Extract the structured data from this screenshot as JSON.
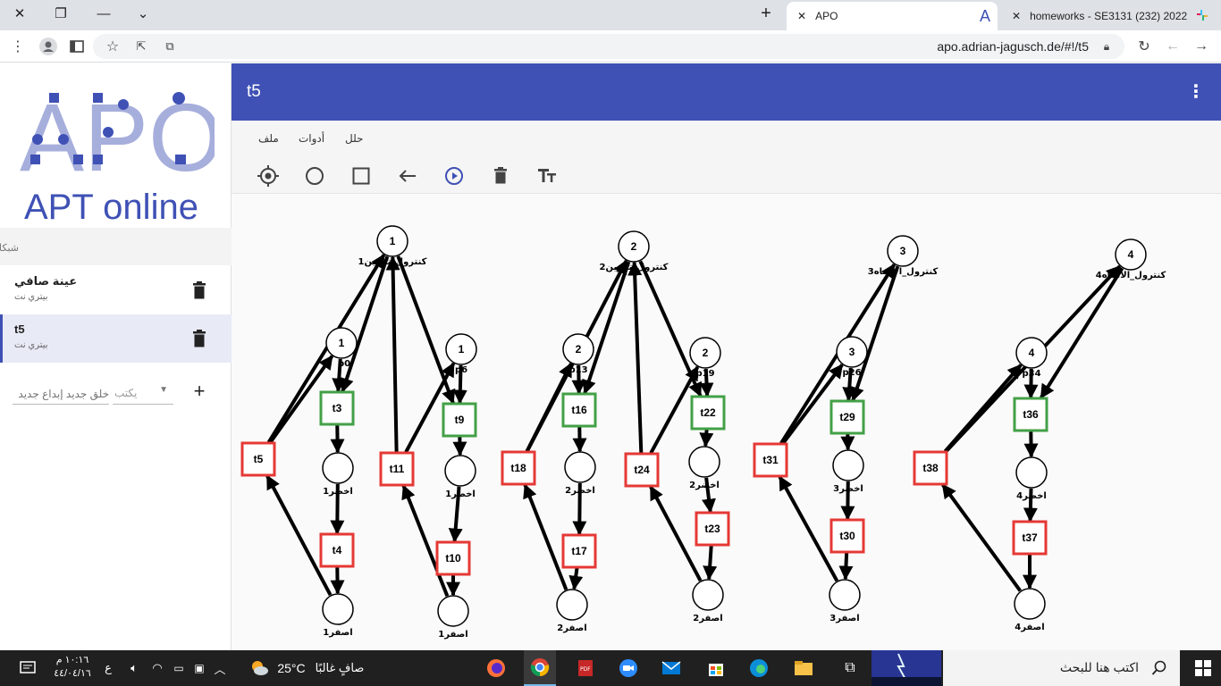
{
  "browser": {
    "tabs": [
      {
        "title": "APO"
      },
      {
        "title": "homeworks - SE3131 (232) 2022"
      }
    ],
    "url": "apo.adrian-jagusch.de/#!/t5"
  },
  "sidebar": {
    "logo_letters": "APO",
    "logo_subtitle": "APT online",
    "section_label": "شبكاتك",
    "nets": [
      {
        "name": "عينة صافي",
        "type": "بيتري نت"
      },
      {
        "name": "t5",
        "type": "بيتري نت"
      }
    ],
    "new_net_placeholder": "خلق جديد إبداع جديد",
    "type_select": "يكتب",
    "add_label": "+"
  },
  "appbar": {
    "title": "t5"
  },
  "menu": {
    "items": [
      "ملف",
      "أدوات",
      "حلل"
    ]
  },
  "tools": [
    "crosshair-icon",
    "circle-icon",
    "square-icon",
    "arrow-left-icon",
    "play-icon",
    "trash-icon",
    "text-format-icon"
  ],
  "colors": {
    "primary": "#3f51b5",
    "enabled_transition": "#43a047",
    "disabled_transition": "#e53935"
  },
  "petri_net": {
    "places": [
      {
        "id": "c1",
        "tokens": "1",
        "label": "كنترول_تخزين1"
      },
      {
        "id": "p0",
        "tokens": "1",
        "label": "p0"
      },
      {
        "id": "p6",
        "tokens": "1",
        "label": "p6"
      },
      {
        "id": "k1",
        "tokens": "",
        "label": "اخضر1"
      },
      {
        "id": "k1b",
        "tokens": "",
        "label": "اخضر1"
      },
      {
        "id": "s1",
        "tokens": "",
        "label": "اصفر1"
      },
      {
        "id": "s1b",
        "tokens": "",
        "label": "اصفر1"
      },
      {
        "id": "c2",
        "tokens": "2",
        "label": "كنترول_تخزين2"
      },
      {
        "id": "p13",
        "tokens": "2",
        "label": "p13"
      },
      {
        "id": "p19",
        "tokens": "2",
        "label": "p19"
      },
      {
        "id": "k2",
        "tokens": "",
        "label": "اخضر2"
      },
      {
        "id": "k2b",
        "tokens": "",
        "label": "اخضر2"
      },
      {
        "id": "s2",
        "tokens": "",
        "label": "اصفر2"
      },
      {
        "id": "s2b",
        "tokens": "",
        "label": "اصفر2"
      },
      {
        "id": "c3",
        "tokens": "3",
        "label": "كنترول_الاتجاه3"
      },
      {
        "id": "p26",
        "tokens": "3",
        "label": "p26"
      },
      {
        "id": "k3",
        "tokens": "",
        "label": "اخضر3"
      },
      {
        "id": "s3",
        "tokens": "",
        "label": "اصفر3"
      },
      {
        "id": "c4",
        "tokens": "4",
        "label": "كنترول_الاتجاه4"
      },
      {
        "id": "p34",
        "tokens": "4",
        "label": "p34"
      },
      {
        "id": "k4",
        "tokens": "",
        "label": "اخضر4"
      },
      {
        "id": "s4",
        "tokens": "",
        "label": "اصفر4"
      }
    ],
    "transitions": [
      {
        "id": "t3",
        "enabled": true
      },
      {
        "id": "t4",
        "enabled": false
      },
      {
        "id": "t5",
        "enabled": false
      },
      {
        "id": "t9",
        "enabled": true
      },
      {
        "id": "t10",
        "enabled": false
      },
      {
        "id": "t11",
        "enabled": false
      },
      {
        "id": "t16",
        "enabled": true
      },
      {
        "id": "t17",
        "enabled": false
      },
      {
        "id": "t18",
        "enabled": false
      },
      {
        "id": "t22",
        "enabled": true
      },
      {
        "id": "t23",
        "enabled": false
      },
      {
        "id": "t24",
        "enabled": false
      },
      {
        "id": "t29",
        "enabled": true
      },
      {
        "id": "t30",
        "enabled": false
      },
      {
        "id": "t31",
        "enabled": false
      },
      {
        "id": "t36",
        "enabled": true
      },
      {
        "id": "t37",
        "enabled": false
      },
      {
        "id": "t38",
        "enabled": false
      }
    ]
  },
  "taskbar": {
    "time": "١٠:١٦ م",
    "date": "٤٤/٠٤/١٦",
    "lang": "ع",
    "weather_temp": "25°C",
    "weather_text": "صافٍ غالبًا",
    "search_placeholder": "اكتب هنا للبحث"
  }
}
